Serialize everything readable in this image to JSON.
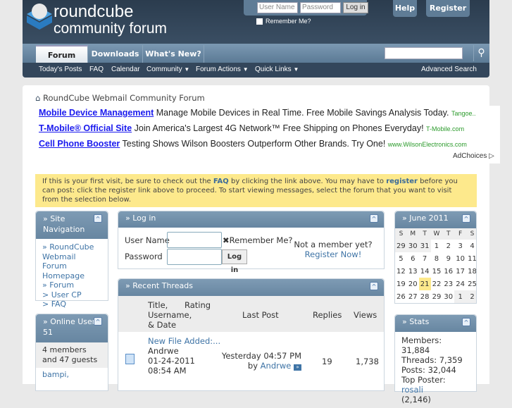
{
  "header": {
    "logo_line1": "roundcube",
    "logo_line2": "community forum",
    "username_placeholder": "User Name",
    "password_placeholder": "Password",
    "login_button": "Log in",
    "remember_me": "Remember Me?",
    "help": "Help",
    "register": "Register"
  },
  "nav": {
    "tabs": [
      "Forum",
      "Downloads",
      "What's New?"
    ],
    "sub": [
      "Today's Posts",
      "FAQ",
      "Calendar",
      "Community",
      "Forum Actions",
      "Quick Links"
    ],
    "advanced_search": "Advanced Search"
  },
  "breadcrumb": "RoundCube Webmail Community Forum",
  "ads": [
    {
      "title": "Mobile Device Management",
      "text": "Manage Mobile Devices in Real Time. Free Mobile Savings Analysis Today.",
      "url": "Tangoe.."
    },
    {
      "title": "T-Mobile® Official Site",
      "text": "Join America's Largest 4G Network™ Free Shipping on Phones Everyday!",
      "url": "T-Mobile.com"
    },
    {
      "title": "Cell Phone Booster",
      "text": "Testing Shows Wilson Boosters Outperform Other Brands. Try One!",
      "url": "www.WilsonElectronics.com"
    }
  ],
  "adchoices": "AdChoices",
  "notice": {
    "p1": "If this is your first visit, be sure to check out the ",
    "faq": "FAQ",
    "p2": " by clicking the link above. You may have to ",
    "register": "register",
    "p3": " before you can post: click the register link above to proceed. To start viewing messages, select the forum that you want to visit from the selection below."
  },
  "site_nav": {
    "title": "» Site Navigation",
    "items": [
      "» RoundCube Webmail Forum Homepage",
      "» Forum",
      "> User CP",
      "> FAQ"
    ]
  },
  "online": {
    "title": "» Online Users",
    "count": "51",
    "summary": "4 members and 47 guests",
    "users": "bampi,"
  },
  "login": {
    "title": "» Log in",
    "username": "User Name",
    "password": "Password",
    "remember": "Remember Me?",
    "button": "Log in",
    "not_member": "Not a member yet?",
    "register_now": "Register Now!"
  },
  "recent": {
    "title": "» Recent Threads",
    "headers": {
      "title": "Title, Username, & Date",
      "rating": "Rating",
      "last_post": "Last Post",
      "replies": "Replies",
      "views": "Views"
    },
    "rows": [
      {
        "title": "New File Added:...",
        "author": "Andrwe",
        "date": "01-24-2011",
        "time": "08:54 AM",
        "last_post": "Yesterday 04:57 PM",
        "by": "by",
        "last_user": "Andrwe",
        "replies": "19",
        "views": "1,738"
      }
    ]
  },
  "calendar": {
    "title": "» June 2011",
    "days": [
      "S",
      "M",
      "T",
      "W",
      "T",
      "F",
      "S"
    ],
    "weeks": [
      [
        "29",
        "30",
        "31",
        "1",
        "2",
        "3",
        "4"
      ],
      [
        "5",
        "6",
        "7",
        "8",
        "9",
        "10",
        "11"
      ],
      [
        "12",
        "13",
        "14",
        "15",
        "16",
        "17",
        "18"
      ],
      [
        "19",
        "20",
        "21",
        "22",
        "23",
        "24",
        "25"
      ],
      [
        "26",
        "27",
        "28",
        "29",
        "30",
        "1",
        "2"
      ]
    ],
    "today": "21"
  },
  "stats": {
    "title": "» Stats",
    "members": "Members: 31,884",
    "threads": "Threads: 7,359",
    "posts": "Posts: 32,044",
    "top_label": "Top Poster: ",
    "top_user": "rosali",
    "top_count": "(2,146)"
  }
}
